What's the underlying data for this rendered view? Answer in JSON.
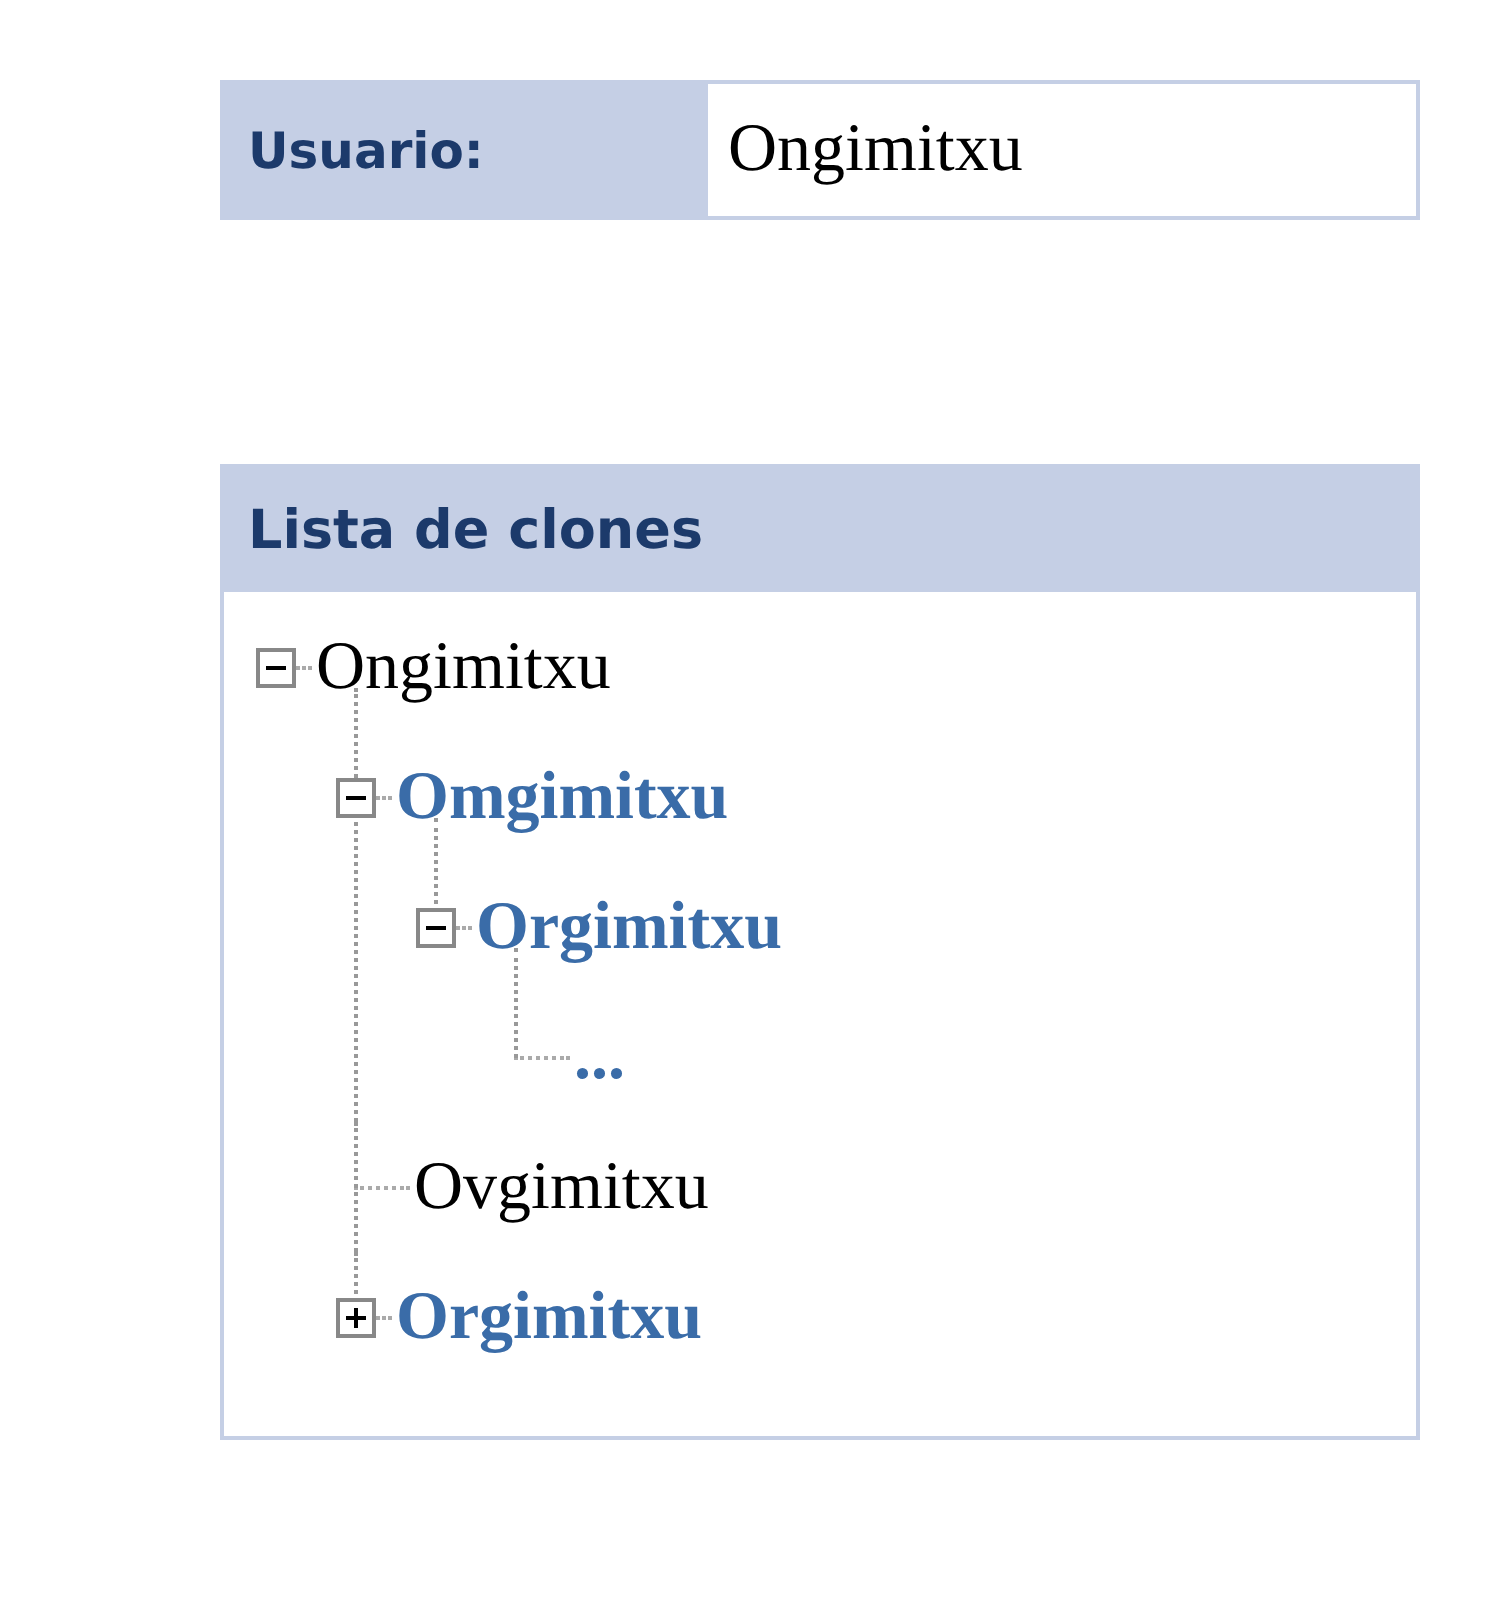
{
  "user": {
    "label": "Usuario:",
    "value": "Ongimitxu"
  },
  "clones": {
    "title": "Lista de clones",
    "tree": [
      {
        "label": "Ongimitxu",
        "kind": "branch",
        "link": false,
        "expanded": true,
        "children": [
          {
            "label": "Omgimitxu",
            "kind": "branch",
            "link": true,
            "expanded": true,
            "children": [
              {
                "label": "Orgimitxu",
                "kind": "branch",
                "link": true,
                "expanded": true,
                "children": [
                  {
                    "label": "...",
                    "kind": "leaf",
                    "link": true
                  }
                ]
              }
            ]
          },
          {
            "label": "Ovgimitxu",
            "kind": "leaf",
            "link": false
          },
          {
            "label": "Orgimitxu",
            "kind": "branch",
            "link": true,
            "expanded": false
          }
        ]
      }
    ]
  }
}
